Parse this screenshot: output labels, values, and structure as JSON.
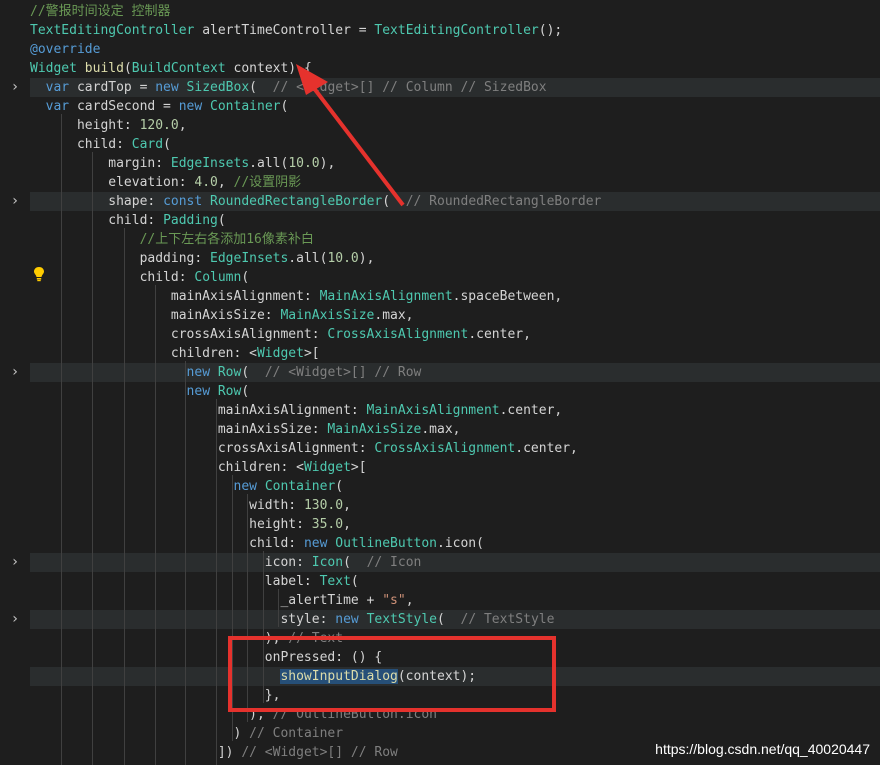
{
  "editor": {
    "lines": [
      [
        {
          "t": "//警报时间设定 控制器",
          "c": "com"
        }
      ],
      [
        {
          "t": "TextEditingController",
          "c": "cls"
        },
        {
          "t": " alertTimeController = ",
          "c": "txt"
        },
        {
          "t": "TextEditingController",
          "c": "cls"
        },
        {
          "t": "();",
          "c": "txt"
        }
      ],
      [
        {
          "t": "@override",
          "c": "dec"
        }
      ],
      [
        {
          "t": "Widget",
          "c": "cls"
        },
        {
          "t": " ",
          "c": "txt"
        },
        {
          "t": "build",
          "c": "fn"
        },
        {
          "t": "(",
          "c": "txt"
        },
        {
          "t": "BuildContext",
          "c": "cls"
        },
        {
          "t": " context) {",
          "c": "txt"
        }
      ],
      [
        {
          "t": "  ",
          "c": "txt"
        },
        {
          "t": "var",
          "c": "kw"
        },
        {
          "t": " cardTop = ",
          "c": "txt"
        },
        {
          "t": "new",
          "c": "kw"
        },
        {
          "t": " ",
          "c": "txt"
        },
        {
          "t": "SizedBox",
          "c": "cls"
        },
        {
          "t": "(  ",
          "c": "txt"
        },
        {
          "t": "// <Widget>[] // Column // SizedBox",
          "c": "ghost"
        }
      ],
      [
        {
          "t": "  ",
          "c": "txt"
        },
        {
          "t": "var",
          "c": "kw"
        },
        {
          "t": " cardSecond = ",
          "c": "txt"
        },
        {
          "t": "new",
          "c": "kw"
        },
        {
          "t": " ",
          "c": "txt"
        },
        {
          "t": "Container",
          "c": "cls"
        },
        {
          "t": "(",
          "c": "txt"
        }
      ],
      [
        {
          "t": "      height: ",
          "c": "txt"
        },
        {
          "t": "120.0",
          "c": "num"
        },
        {
          "t": ",",
          "c": "txt"
        }
      ],
      [
        {
          "t": "      child: ",
          "c": "txt"
        },
        {
          "t": "Card",
          "c": "cls"
        },
        {
          "t": "(",
          "c": "txt"
        }
      ],
      [
        {
          "t": "          margin: ",
          "c": "txt"
        },
        {
          "t": "EdgeInsets",
          "c": "cls"
        },
        {
          "t": ".all(",
          "c": "txt"
        },
        {
          "t": "10.0",
          "c": "num"
        },
        {
          "t": "),",
          "c": "txt"
        }
      ],
      [
        {
          "t": "          elevation: ",
          "c": "txt"
        },
        {
          "t": "4.0",
          "c": "num"
        },
        {
          "t": ", ",
          "c": "txt"
        },
        {
          "t": "//设置阴影",
          "c": "com"
        }
      ],
      [
        {
          "t": "          shape: ",
          "c": "txt"
        },
        {
          "t": "const",
          "c": "kw"
        },
        {
          "t": " ",
          "c": "txt"
        },
        {
          "t": "RoundedRectangleBorder",
          "c": "cls"
        },
        {
          "t": "(  ",
          "c": "txt"
        },
        {
          "t": "// RoundedRectangleBorder",
          "c": "ghost"
        }
      ],
      [
        {
          "t": "          child: ",
          "c": "txt"
        },
        {
          "t": "Padding",
          "c": "cls"
        },
        {
          "t": "(",
          "c": "txt"
        }
      ],
      [
        {
          "t": "              ",
          "c": "txt"
        },
        {
          "t": "//上下左右各添加16像素补白",
          "c": "com"
        }
      ],
      [
        {
          "t": "              padding: ",
          "c": "txt"
        },
        {
          "t": "EdgeInsets",
          "c": "cls"
        },
        {
          "t": ".all(",
          "c": "txt"
        },
        {
          "t": "10.0",
          "c": "num"
        },
        {
          "t": "),",
          "c": "txt"
        }
      ],
      [
        {
          "t": "              child: ",
          "c": "txt"
        },
        {
          "t": "Column",
          "c": "cls"
        },
        {
          "t": "(",
          "c": "txt"
        }
      ],
      [
        {
          "t": "                  mainAxisAlignment: ",
          "c": "txt"
        },
        {
          "t": "MainAxisAlignment",
          "c": "cls"
        },
        {
          "t": ".spaceBetween,",
          "c": "txt"
        }
      ],
      [
        {
          "t": "                  mainAxisSize: ",
          "c": "txt"
        },
        {
          "t": "MainAxisSize",
          "c": "cls"
        },
        {
          "t": ".max,",
          "c": "txt"
        }
      ],
      [
        {
          "t": "                  crossAxisAlignment: ",
          "c": "txt"
        },
        {
          "t": "CrossAxisAlignment",
          "c": "cls"
        },
        {
          "t": ".center,",
          "c": "txt"
        }
      ],
      [
        {
          "t": "                  children: <",
          "c": "txt"
        },
        {
          "t": "Widget",
          "c": "cls"
        },
        {
          "t": ">[",
          "c": "txt"
        }
      ],
      [
        {
          "t": "                    ",
          "c": "txt"
        },
        {
          "t": "new",
          "c": "kw"
        },
        {
          "t": " ",
          "c": "txt"
        },
        {
          "t": "Row",
          "c": "cls"
        },
        {
          "t": "(  ",
          "c": "txt"
        },
        {
          "t": "// <Widget>[] // Row",
          "c": "ghost"
        }
      ],
      [
        {
          "t": "                    ",
          "c": "txt"
        },
        {
          "t": "new",
          "c": "kw"
        },
        {
          "t": " ",
          "c": "txt"
        },
        {
          "t": "Row",
          "c": "cls"
        },
        {
          "t": "(",
          "c": "txt"
        }
      ],
      [
        {
          "t": "                        mainAxisAlignment: ",
          "c": "txt"
        },
        {
          "t": "MainAxisAlignment",
          "c": "cls"
        },
        {
          "t": ".center,",
          "c": "txt"
        }
      ],
      [
        {
          "t": "                        mainAxisSize: ",
          "c": "txt"
        },
        {
          "t": "MainAxisSize",
          "c": "cls"
        },
        {
          "t": ".max,",
          "c": "txt"
        }
      ],
      [
        {
          "t": "                        crossAxisAlignment: ",
          "c": "txt"
        },
        {
          "t": "CrossAxisAlignment",
          "c": "cls"
        },
        {
          "t": ".center,",
          "c": "txt"
        }
      ],
      [
        {
          "t": "                        children: <",
          "c": "txt"
        },
        {
          "t": "Widget",
          "c": "cls"
        },
        {
          "t": ">[",
          "c": "txt"
        }
      ],
      [
        {
          "t": "                          ",
          "c": "txt"
        },
        {
          "t": "new",
          "c": "kw"
        },
        {
          "t": " ",
          "c": "txt"
        },
        {
          "t": "Container",
          "c": "cls"
        },
        {
          "t": "(",
          "c": "txt"
        }
      ],
      [
        {
          "t": "                            width: ",
          "c": "txt"
        },
        {
          "t": "130.0",
          "c": "num"
        },
        {
          "t": ",",
          "c": "txt"
        }
      ],
      [
        {
          "t": "                            height: ",
          "c": "txt"
        },
        {
          "t": "35.0",
          "c": "num"
        },
        {
          "t": ",",
          "c": "txt"
        }
      ],
      [
        {
          "t": "                            child: ",
          "c": "txt"
        },
        {
          "t": "new",
          "c": "kw"
        },
        {
          "t": " ",
          "c": "txt"
        },
        {
          "t": "OutlineButton",
          "c": "cls"
        },
        {
          "t": ".icon(",
          "c": "txt"
        }
      ],
      [
        {
          "t": "                              icon: ",
          "c": "txt"
        },
        {
          "t": "Icon",
          "c": "cls"
        },
        {
          "t": "(  ",
          "c": "txt"
        },
        {
          "t": "// Icon",
          "c": "ghost"
        }
      ],
      [
        {
          "t": "                              label: ",
          "c": "txt"
        },
        {
          "t": "Text",
          "c": "cls"
        },
        {
          "t": "(",
          "c": "txt"
        }
      ],
      [
        {
          "t": "                                _alertTime + ",
          "c": "txt"
        },
        {
          "t": "\"s\"",
          "c": "str"
        },
        {
          "t": ",",
          "c": "txt"
        }
      ],
      [
        {
          "t": "                                style: ",
          "c": "txt"
        },
        {
          "t": "new",
          "c": "kw"
        },
        {
          "t": " ",
          "c": "txt"
        },
        {
          "t": "TextStyle",
          "c": "cls"
        },
        {
          "t": "(  ",
          "c": "txt"
        },
        {
          "t": "// TextStyle",
          "c": "ghost"
        }
      ],
      [
        {
          "t": "                              ), ",
          "c": "txt"
        },
        {
          "t": "// Text",
          "c": "ghost"
        }
      ],
      [
        {
          "t": "                              onPressed: () {",
          "c": "txt"
        }
      ],
      [
        {
          "t": "                                ",
          "c": "txt"
        },
        {
          "t": "showInputDialog",
          "c": "fn",
          "sel": true
        },
        {
          "t": "(context);",
          "c": "txt"
        }
      ],
      [
        {
          "t": "                              },",
          "c": "txt"
        }
      ],
      [
        {
          "t": "                            ), ",
          "c": "txt"
        },
        {
          "t": "// OutlineButton.icon",
          "c": "ghost"
        }
      ],
      [
        {
          "t": "                          ) ",
          "c": "txt"
        },
        {
          "t": "// Container",
          "c": "ghost"
        }
      ],
      [
        {
          "t": "                        ]) ",
          "c": "txt"
        },
        {
          "t": "// <Widget>[] // Row",
          "c": "ghost"
        }
      ]
    ],
    "folded_lines": [
      4,
      10,
      19,
      29,
      32
    ],
    "highlighted_lines": [
      4,
      10,
      19,
      29,
      32
    ],
    "current_line": 35
  },
  "overlay": {
    "watermark": "https://blog.csdn.net/qq_40020447",
    "arrow_color": "#e5322d",
    "box_color": "#e5322d"
  }
}
